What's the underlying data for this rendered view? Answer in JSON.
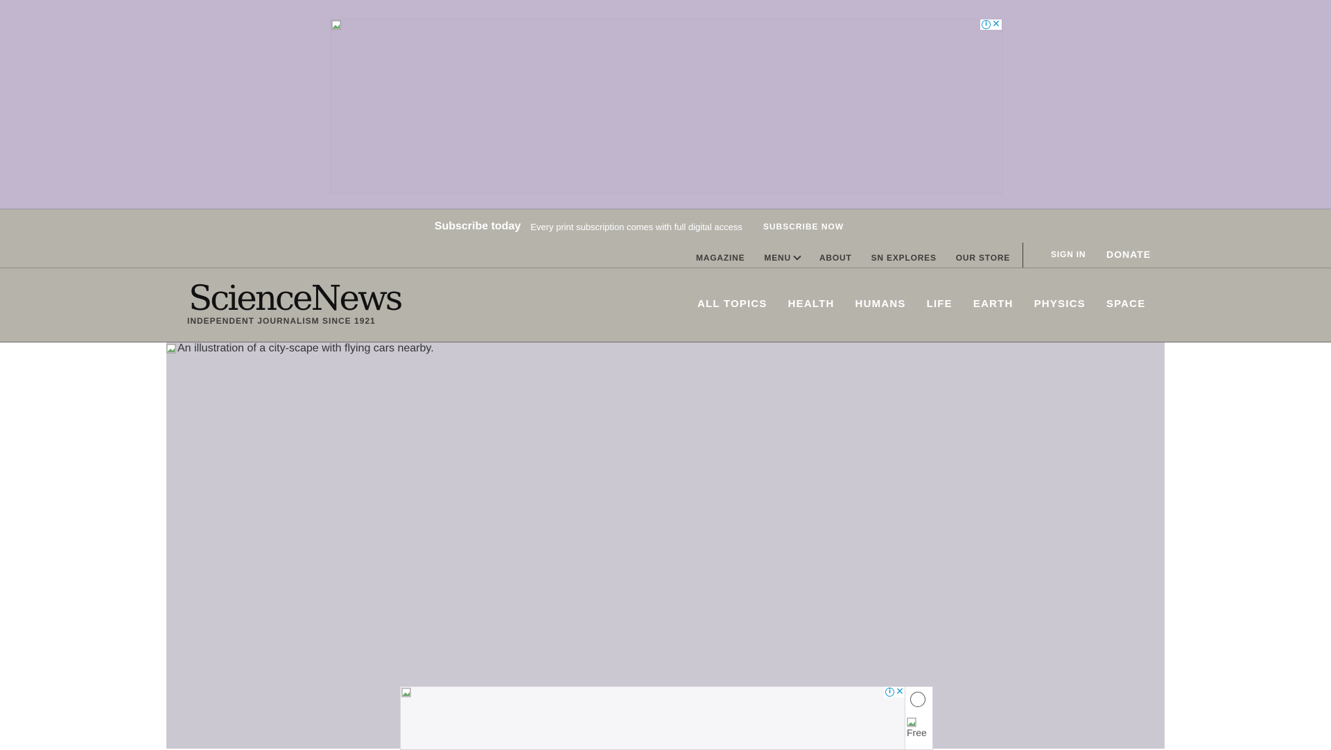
{
  "subscribe": {
    "title": "Subscribe today",
    "description": "Every print subscription comes with full digital access",
    "button": "SUBSCRIBE NOW"
  },
  "utility_nav": {
    "magazine": "MAGAZINE",
    "menu": "MENU",
    "about": "ABOUT",
    "sn_explores": "SN EXPLORES",
    "our_store": "OUR STORE",
    "sign_in": "SIGN IN",
    "donate": "DONATE"
  },
  "brand": {
    "logo": "ScienceNews",
    "tagline": "INDEPENDENT JOURNALISM SINCE 1921"
  },
  "main_nav": [
    "ALL TOPICS",
    "HEALTH",
    "HUMANS",
    "LIFE",
    "EARTH",
    "PHYSICS",
    "SPACE"
  ],
  "hero": {
    "alt_text": "An illustration of a city-scape with flying cars nearby."
  },
  "bottom_ad": {
    "side_image_alt": "Free"
  },
  "colors": {
    "ad_band": "#c2b6cf",
    "header": "#b6b3ab",
    "hero_placeholder": "#cbc8d2",
    "adchoice_blue": "#1a9bd6"
  },
  "icons": [
    "broken-image-icon",
    "ad-info-icon",
    "ad-close-icon",
    "chevron-down-icon",
    "circle-icon"
  ]
}
